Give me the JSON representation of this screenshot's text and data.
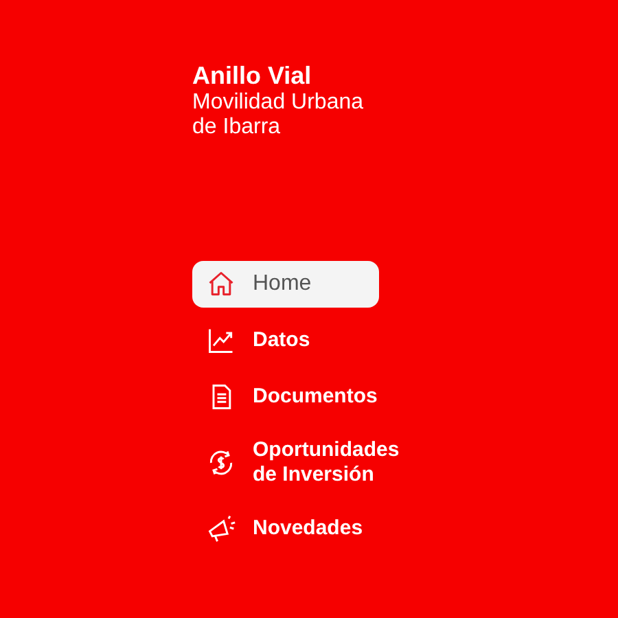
{
  "brand": {
    "title": "Anillo Vial",
    "subtitle": "Movilidad Urbana de Ibarra"
  },
  "nav": [
    {
      "label": "Home",
      "selected": true
    },
    {
      "label": "Datos",
      "selected": false
    },
    {
      "label": "Documentos",
      "selected": false
    },
    {
      "label": "Oportunidades de Inversión",
      "selected": false
    },
    {
      "label": "Novedades",
      "selected": false
    }
  ]
}
